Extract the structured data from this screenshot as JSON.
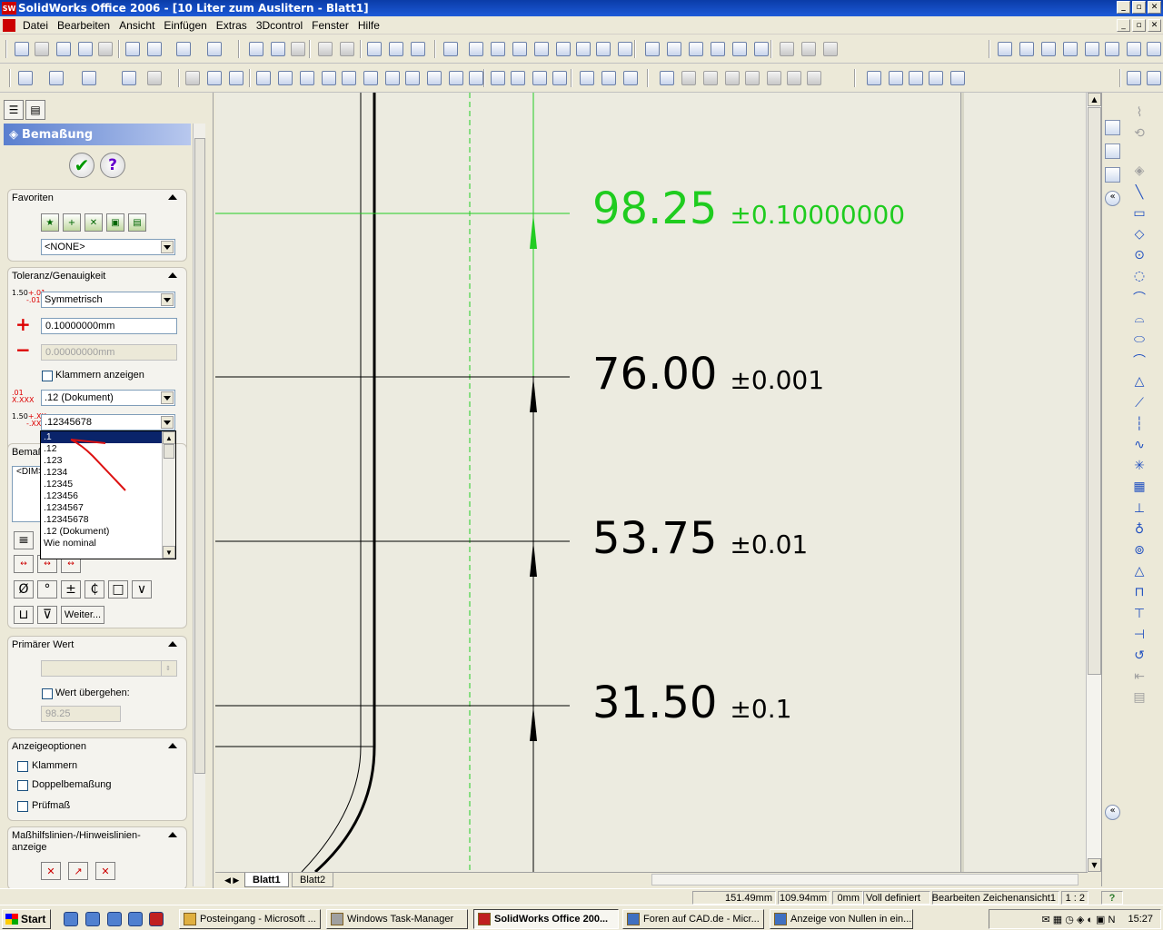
{
  "window": {
    "title": "SolidWorks Office 2006 - [10 Liter zum Auslitern - Blatt1]",
    "logo": "SW"
  },
  "menu": [
    "Datei",
    "Bearbeiten",
    "Ansicht",
    "Einfügen",
    "Extras",
    "3Dcontrol",
    "Fenster",
    "Hilfe"
  ],
  "property_manager": {
    "title": "Bemaßung",
    "favoriten": {
      "title": "Favoriten",
      "selected": "<NONE>"
    },
    "toleranz": {
      "title": "Toleranz/Genauigkeit",
      "type": "Symmetrisch",
      "plus_value": "0.10000000mm",
      "minus_value": "0.00000000mm",
      "klammern_label": "Klammern anzeigen",
      "primary_precision": ".12 (Dokument)",
      "tolerance_precision": ".12345678",
      "icon_text_1": "1.50",
      "icon_text_1_sup": "+.01",
      "icon_text_1_sub": "-.01",
      "icon_text_3": "1.50",
      "icon_text_3_sup": "+.XX",
      "icon_text_3_sub": "-.XX"
    },
    "precision_options": [
      ".1",
      ".12",
      ".123",
      ".1234",
      ".12345",
      ".123456",
      ".1234567",
      ".12345678",
      ".12 (Dokument)",
      "Wie nominal"
    ],
    "bemassungstext": {
      "title": "Bemaß",
      "text": "<DIM>"
    },
    "symbols": [
      "Ø",
      "°",
      "±",
      "₵",
      "□",
      "∨",
      "⊔",
      "⊽"
    ],
    "weiter_label": "Weiter...",
    "primaerer_wert": {
      "title": "Primärer Wert",
      "override_label": "Wert übergehen:",
      "value": "98.25"
    },
    "anzeigeoptionen": {
      "title": "Anzeigeoptionen",
      "options": [
        "Klammern",
        "Doppelbemaßung",
        "Prüfmaß"
      ]
    },
    "masshilfslinien": {
      "title_line1": "Maßhilfslinien-/Hinweislinien-",
      "title_line2": "anzeige"
    }
  },
  "drawing": {
    "dimensions": [
      {
        "value": "98.25",
        "tolerance": "±0.10000000",
        "color": "#1fcc1f"
      },
      {
        "value": "76.00",
        "tolerance": "±0.001",
        "color": "#000000"
      },
      {
        "value": "53.75",
        "tolerance": "±0.01",
        "color": "#000000"
      },
      {
        "value": "31.50",
        "tolerance": "±0.1",
        "color": "#000000"
      }
    ],
    "sheet_tabs": [
      "Blatt1",
      "Blatt2"
    ]
  },
  "status": {
    "x": "151.49mm",
    "y": "109.94mm",
    "z": "0mm",
    "state": "Voll definiert",
    "mode": "Bearbeiten Zeichenansicht1",
    "scale": "1 : 2",
    "help": "?"
  },
  "taskbar": {
    "start": "Start",
    "tasks": [
      {
        "label": "Posteingang - Microsoft ...",
        "active": false
      },
      {
        "label": "Windows Task-Manager",
        "active": false
      },
      {
        "label": "SolidWorks Office 200...",
        "active": true
      },
      {
        "label": "Foren auf CAD.de - Micr...",
        "active": false
      },
      {
        "label": "Anzeige von Nullen in ein...",
        "active": false
      }
    ],
    "clock": "15:27"
  },
  "colors": {
    "selected_dimension": "#1fcc1f",
    "annotation_arrow": "#dd1111",
    "title_bar": "#0a3ca8"
  }
}
